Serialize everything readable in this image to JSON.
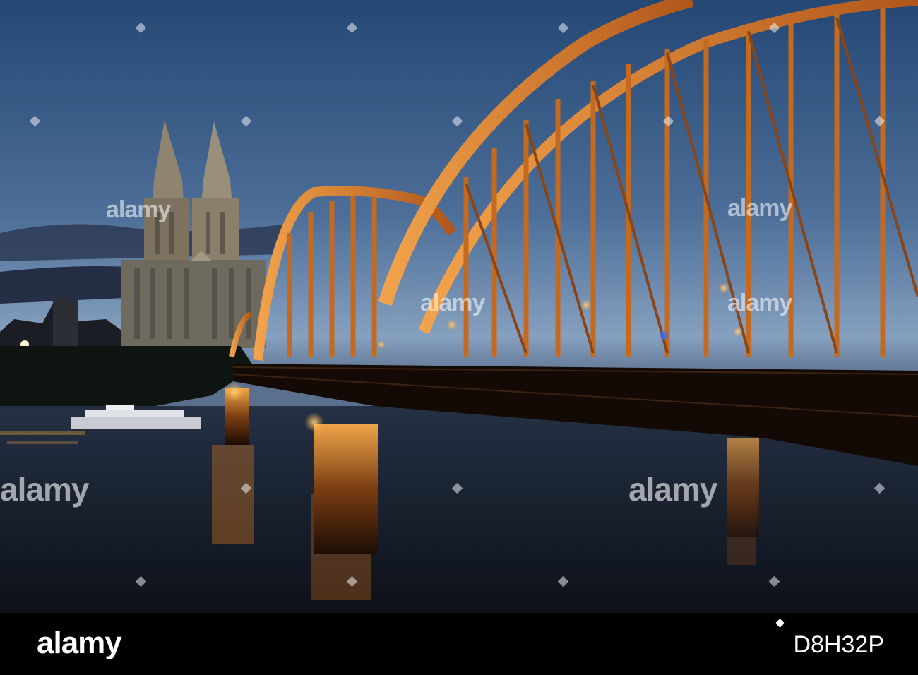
{
  "photo": {
    "alt": "",
    "watermark_text": "alamy",
    "colors": {
      "sky_top": "#2d4f7c",
      "sky_mid": "#5f7fa6",
      "sky_bottom": "#8aa0bd",
      "bridge_light": "#e98a2e",
      "bridge_dark": "#3a1c08",
      "water": "#1a2230",
      "lamp": "#ffb347",
      "cathedral": "#9c8f78"
    }
  },
  "footer": {
    "logo": "alamy",
    "image_id": "D8H32P"
  }
}
